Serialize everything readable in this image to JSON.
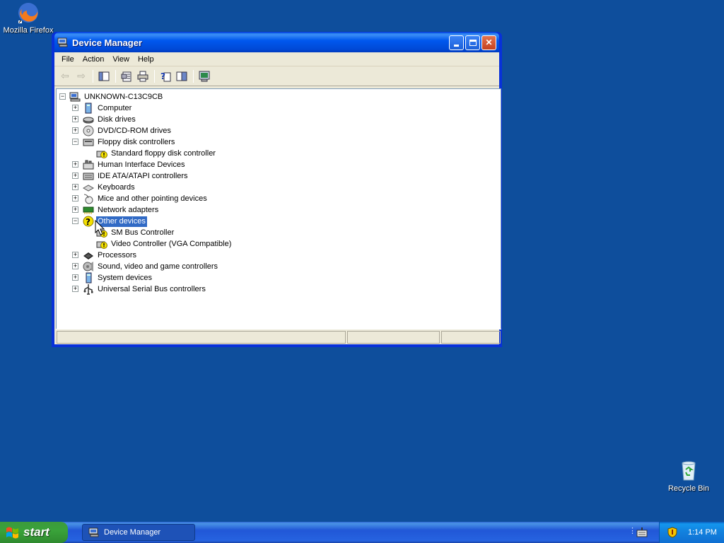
{
  "desktop": {
    "icons": [
      {
        "label": "Mozilla Firefox",
        "icon": "firefox-icon"
      },
      {
        "label": "Recycle Bin",
        "icon": "recycle-bin-icon"
      }
    ]
  },
  "window": {
    "title": "Device Manager",
    "menu": [
      "File",
      "Action",
      "View",
      "Help"
    ],
    "toolbar": [
      "back-icon",
      "forward-icon",
      "show-hide-tree-icon",
      "properties-icon",
      "print-icon",
      "help-icon",
      "view-icon",
      "scan-hardware-icon"
    ],
    "tree": {
      "root": "UNKNOWN-C13C9CB",
      "nodes": [
        {
          "label": "Computer",
          "icon": "computer-icon",
          "expander": "+"
        },
        {
          "label": "Disk drives",
          "icon": "disk-drive-icon",
          "expander": "+"
        },
        {
          "label": "DVD/CD-ROM drives",
          "icon": "cdrom-icon",
          "expander": "+"
        },
        {
          "label": "Floppy disk controllers",
          "icon": "floppy-controller-icon",
          "expander": "−"
        },
        {
          "label": "Standard floppy disk controller",
          "icon": "warning-device-icon",
          "child": true
        },
        {
          "label": "Human Interface Devices",
          "icon": "hid-icon",
          "expander": "+"
        },
        {
          "label": "IDE ATA/ATAPI controllers",
          "icon": "ide-icon",
          "expander": "+"
        },
        {
          "label": "Keyboards",
          "icon": "keyboard-icon",
          "expander": "+"
        },
        {
          "label": "Mice and other pointing devices",
          "icon": "mouse-icon",
          "expander": "+"
        },
        {
          "label": "Network adapters",
          "icon": "network-adapter-icon",
          "expander": "+"
        },
        {
          "label": "Other devices",
          "icon": "unknown-device-icon",
          "expander": "−",
          "selected": true
        },
        {
          "label": "SM Bus Controller",
          "icon": "warning-device-icon",
          "child": true
        },
        {
          "label": "Video Controller (VGA Compatible)",
          "icon": "warning-device-icon",
          "child": true
        },
        {
          "label": "Processors",
          "icon": "processor-icon",
          "expander": "+"
        },
        {
          "label": "Sound, video and game controllers",
          "icon": "sound-icon",
          "expander": "+"
        },
        {
          "label": "System devices",
          "icon": "system-device-icon",
          "expander": "+"
        },
        {
          "label": "Universal Serial Bus controllers",
          "icon": "usb-icon",
          "expander": "+"
        }
      ]
    }
  },
  "taskbar": {
    "start_label": "start",
    "task_label": "Device Manager",
    "clock": "1:14 PM"
  },
  "colors": {
    "desktop": "#0e4e9c",
    "selection": "#316ac5",
    "warning": "#f5e100"
  }
}
